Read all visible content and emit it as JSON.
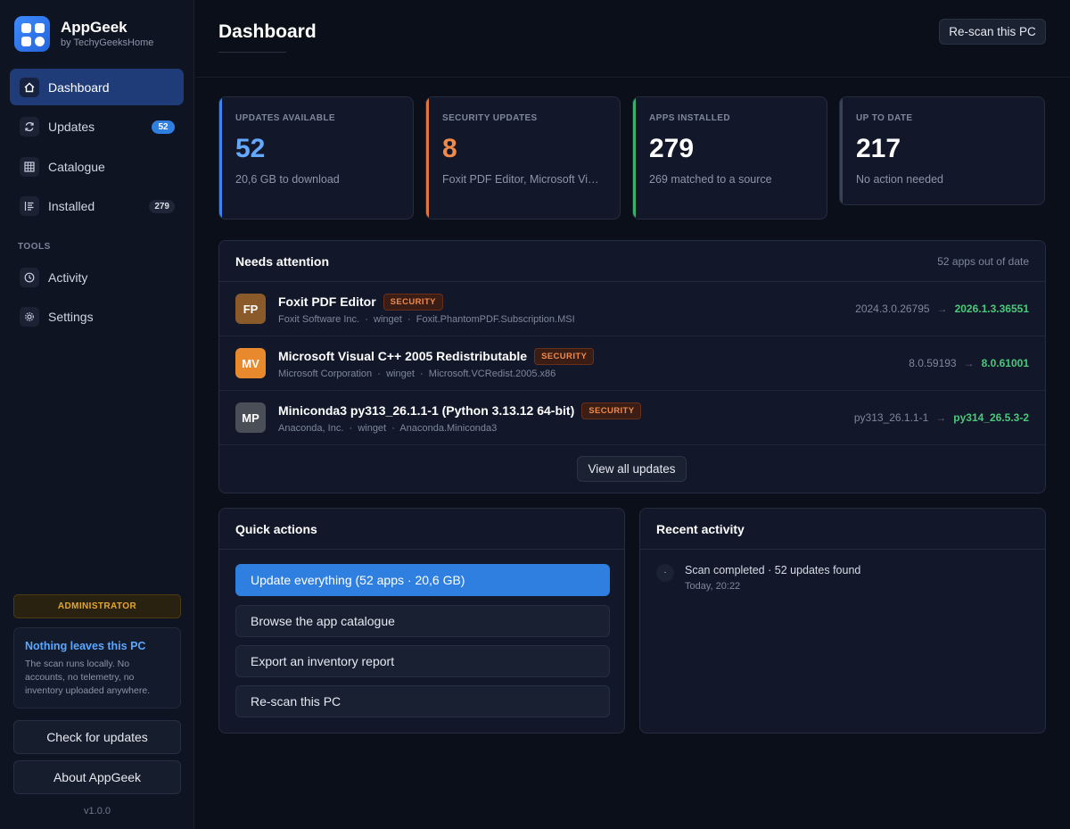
{
  "brand": {
    "name": "AppGeek",
    "subtitle": "by TechyGeeksHome"
  },
  "nav": {
    "items": [
      {
        "label": "Dashboard",
        "icon": "home-icon",
        "active": true
      },
      {
        "label": "Updates",
        "icon": "refresh-icon",
        "badge": "52"
      },
      {
        "label": "Catalogue",
        "icon": "grid-icon"
      },
      {
        "label": "Installed",
        "icon": "list-icon",
        "badge": "279"
      }
    ],
    "tools_label": "TOOLS",
    "tools": [
      {
        "label": "Activity",
        "icon": "clock-icon"
      },
      {
        "label": "Settings",
        "icon": "gear-icon"
      }
    ]
  },
  "sidebar_footer": {
    "role_badge": "ADMINISTRATOR",
    "privacy_title": "Nothing leaves this PC",
    "privacy_text": "The scan runs locally. No accounts, no telemetry, no inventory uploaded anywhere.",
    "check_updates": "Check for updates",
    "about": "About AppGeek",
    "version": "v1.0.0"
  },
  "header": {
    "title": "Dashboard",
    "rescan": "Re-scan this PC"
  },
  "stats": [
    {
      "label": "UPDATES AVAILABLE",
      "value": "52",
      "sub": "20,6 GB to download",
      "accent": "#3a86f0"
    },
    {
      "label": "SECURITY UPDATES",
      "value": "8",
      "sub": "Foxit PDF Editor, Microsoft Visu...",
      "accent": "#e0763a"
    },
    {
      "label": "APPS INSTALLED",
      "value": "279",
      "sub": "269 matched to a source",
      "accent": "#37b26c"
    },
    {
      "label": "UP TO DATE",
      "value": "217",
      "sub": "No action needed",
      "accent": "#3a4256"
    }
  ],
  "attention": {
    "title": "Needs attention",
    "meta": "52 apps out of date",
    "tag": "SECURITY",
    "sep": "·",
    "arrow": "→",
    "apps": [
      {
        "initials": "FP",
        "color": "#8a5a2b",
        "name": "Foxit PDF Editor",
        "publisher": "Foxit Software Inc.",
        "source": "winget",
        "id": "Foxit.PhantomPDF.Subscription.MSI",
        "current": "2024.3.0.26795",
        "latest": "2026.1.3.36551"
      },
      {
        "initials": "MV",
        "color": "#e8892e",
        "name": "Microsoft Visual C++ 2005 Redistributable",
        "publisher": "Microsoft Corporation",
        "source": "winget",
        "id": "Microsoft.VCRedist.2005.x86",
        "current": "8.0.59193",
        "latest": "8.0.61001"
      },
      {
        "initials": "MP",
        "color": "#4a4e57",
        "name": "Miniconda3 py313_26.1.1-1 (Python 3.13.12 64-bit)",
        "publisher": "Anaconda, Inc.",
        "source": "winget",
        "id": "Anaconda.Miniconda3",
        "current": "py313_26.1.1-1",
        "latest": "py314_26.5.3-2"
      }
    ],
    "view_all": "View all updates"
  },
  "quick_actions": {
    "title": "Quick actions",
    "buttons": [
      "Update everything (52 apps · 20,6 GB)",
      "Browse the app catalogue",
      "Export an inventory report",
      "Re-scan this PC"
    ]
  },
  "recent_activity": {
    "title": "Recent activity",
    "items": [
      {
        "text": "Scan completed · 52 updates found",
        "time": "Today, 20:22",
        "marker": "·"
      }
    ]
  }
}
